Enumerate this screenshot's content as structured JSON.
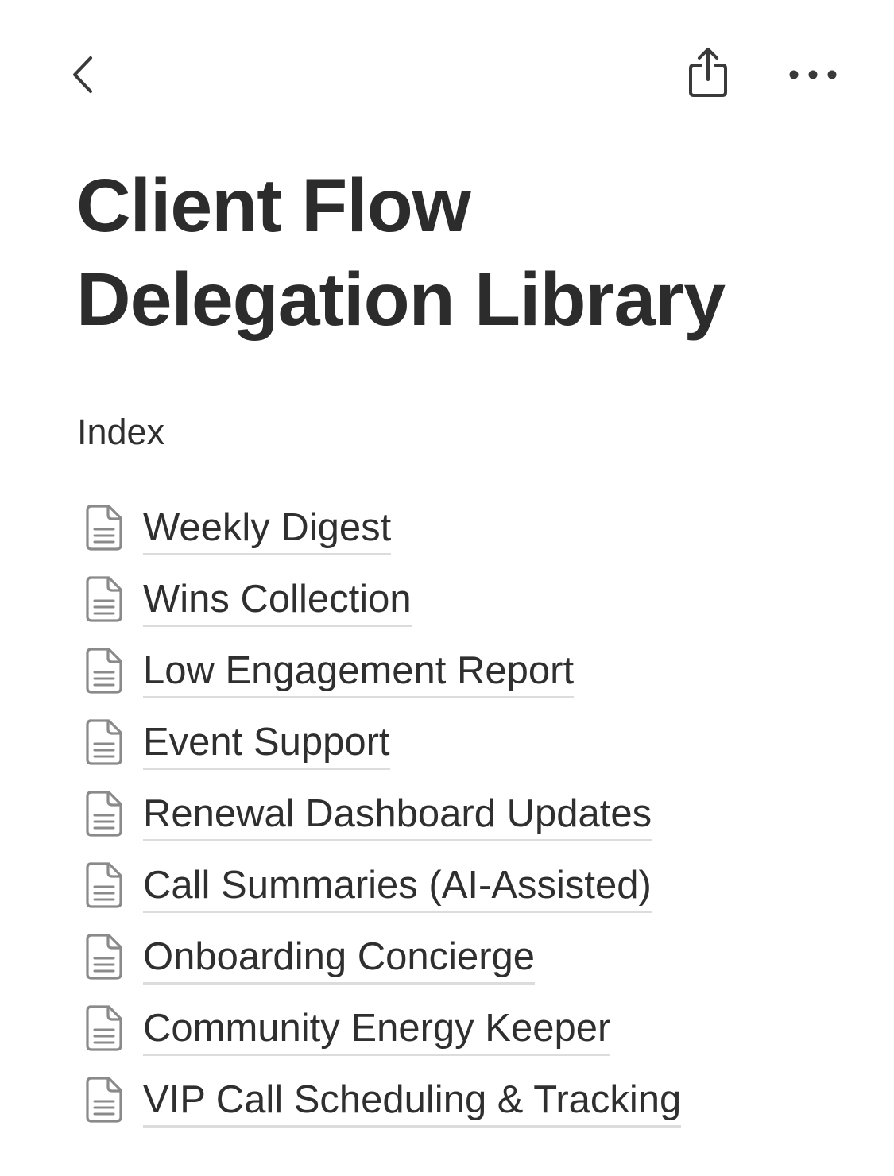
{
  "toolbar": {
    "back_icon": "chevron-left-icon",
    "share_icon": "share-icon",
    "more_icon": "more-horizontal-icon"
  },
  "page": {
    "title_line1": "Client Flow",
    "title_line2": "Delegation Library",
    "section_label": "Index",
    "item_icon": "page-document-icon",
    "items": [
      {
        "label": "Weekly Digest"
      },
      {
        "label": "Wins Collection"
      },
      {
        "label": "Low Engagement Report"
      },
      {
        "label": "Event Support"
      },
      {
        "label": "Renewal Dashboard Updates"
      },
      {
        "label": "Call Summaries (AI-Assisted)"
      },
      {
        "label": "Onboarding Concierge"
      },
      {
        "label": "Community Energy Keeper"
      },
      {
        "label": "VIP Call Scheduling & Tracking"
      }
    ]
  },
  "colors": {
    "text": "#2f2f2f",
    "icon": "#8a8a8a",
    "underline": "#dcdcdc",
    "background": "#ffffff"
  }
}
